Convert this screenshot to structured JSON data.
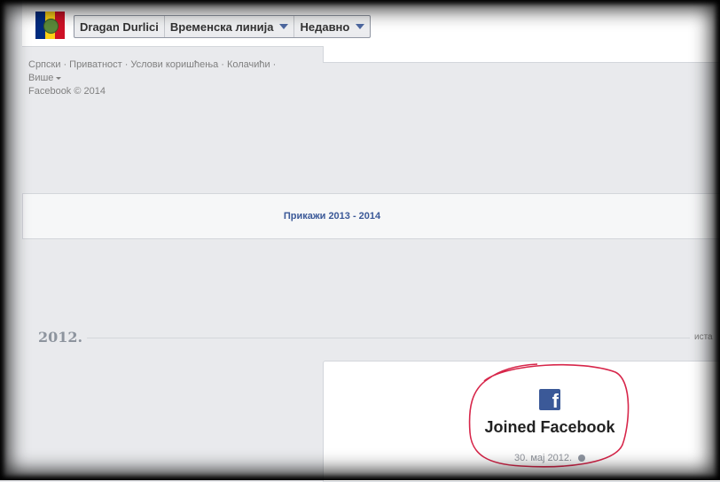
{
  "header": {
    "profile_name": "Dragan Durlici",
    "timeline_label": "Временска линија",
    "recent_label": "Недавно"
  },
  "footer": {
    "links": [
      "Српски",
      "Приватност",
      "Услови коришћења",
      "Колачићи"
    ],
    "more_label": "Више",
    "copyright": "Facebook © 2014"
  },
  "show_more": {
    "label": "Прикажи 2013 - 2014"
  },
  "year_section": {
    "year": "2012.",
    "history_label": "иста"
  },
  "event": {
    "icon": "facebook-icon",
    "title": "Joined Facebook",
    "date": "30. мај 2012."
  },
  "colors": {
    "facebook_blue": "#3b5998",
    "highlight_red": "#d7264a",
    "background": "#e9eaed"
  }
}
